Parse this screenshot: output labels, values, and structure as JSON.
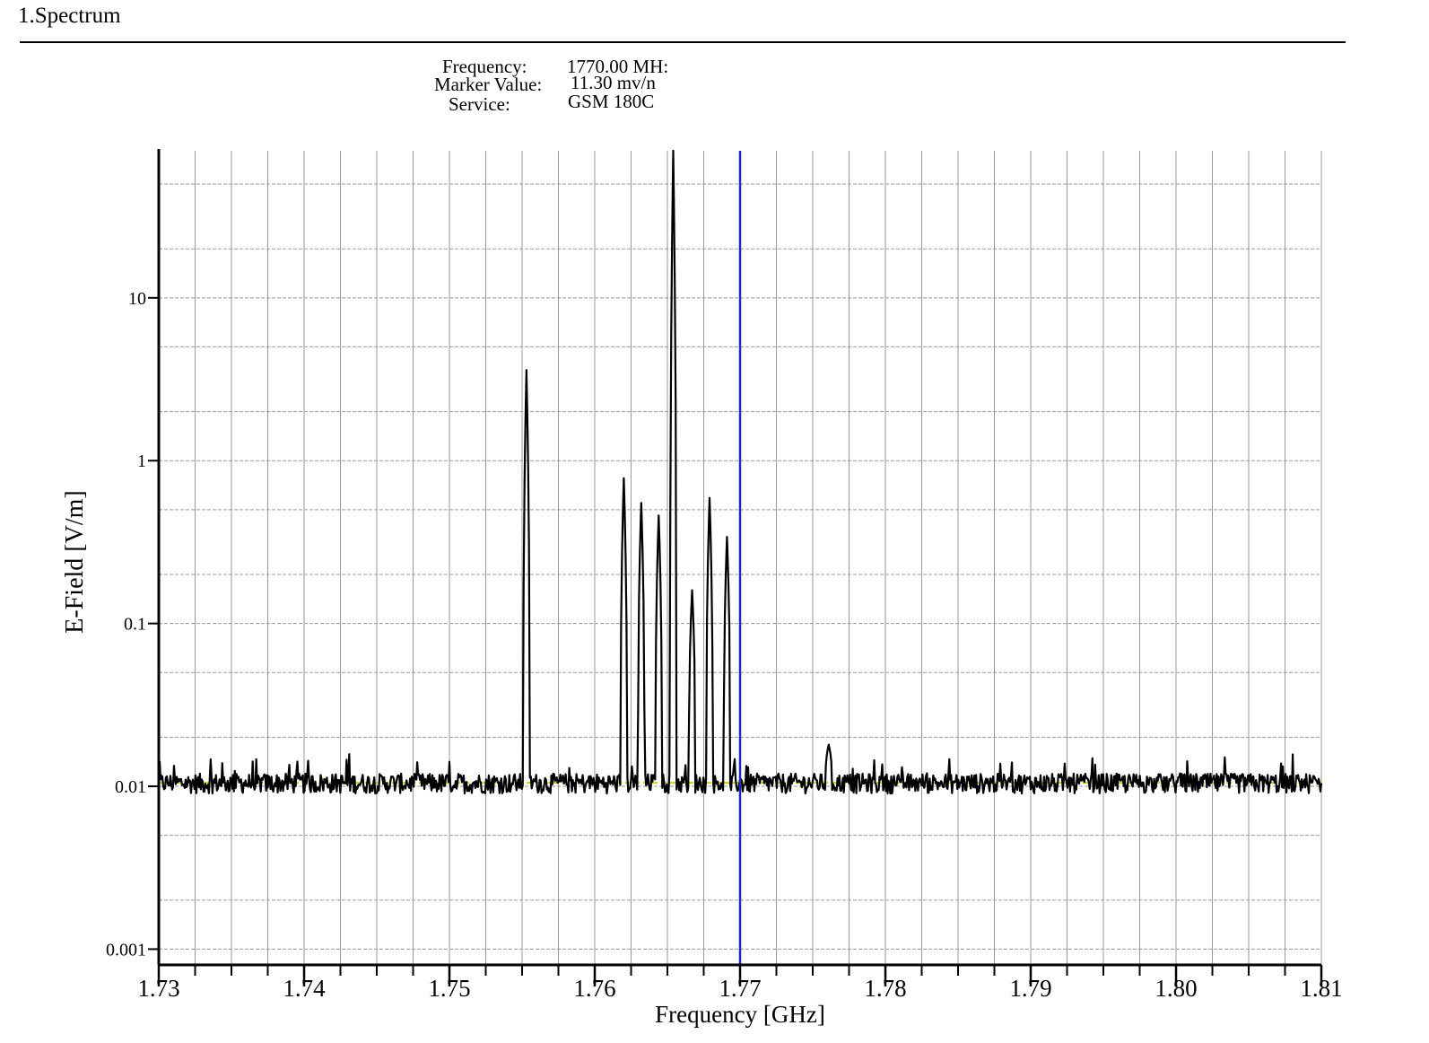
{
  "header": {
    "section_title": "1.Spectrum",
    "info": [
      {
        "label": "Frequency:",
        "value": "1770.00 MH:"
      },
      {
        "label": "Marker Value:",
        "value": "11.30 mv/n"
      },
      {
        "label": "Service:",
        "value": "GSM 180C"
      }
    ]
  },
  "chart_data": {
    "type": "line",
    "xlabel": "Frequency [GHz]",
    "ylabel": "E-Field [V/m]",
    "xlim": [
      1.73,
      1.81
    ],
    "ylim": [
      0.0008,
      80
    ],
    "y_scale": "log",
    "x_ticks": [
      "1.73",
      "1.74",
      "1.75",
      "1.76",
      "1.77",
      "1.78",
      "1.79",
      "1.80",
      "1.81"
    ],
    "y_ticks": [
      "0.001",
      "0.01",
      "0.1",
      "1",
      "10"
    ],
    "grid": true,
    "marker": {
      "x": 1.77,
      "color": "#1a2fb0"
    },
    "noise_floor": 0.0105,
    "threshold_color": "#d8c800",
    "series": [
      {
        "color": "#000000",
        "peaks": [
          {
            "x": 1.7553,
            "y": 3.6
          },
          {
            "x": 1.762,
            "y": 0.78
          },
          {
            "x": 1.7632,
            "y": 0.55
          },
          {
            "x": 1.7644,
            "y": 0.46
          },
          {
            "x": 1.7654,
            "y": 80
          },
          {
            "x": 1.7667,
            "y": 0.16
          },
          {
            "x": 1.7679,
            "y": 0.59
          },
          {
            "x": 1.7691,
            "y": 0.34
          },
          {
            "x": 1.7761,
            "y": 0.018
          }
        ]
      }
    ]
  }
}
